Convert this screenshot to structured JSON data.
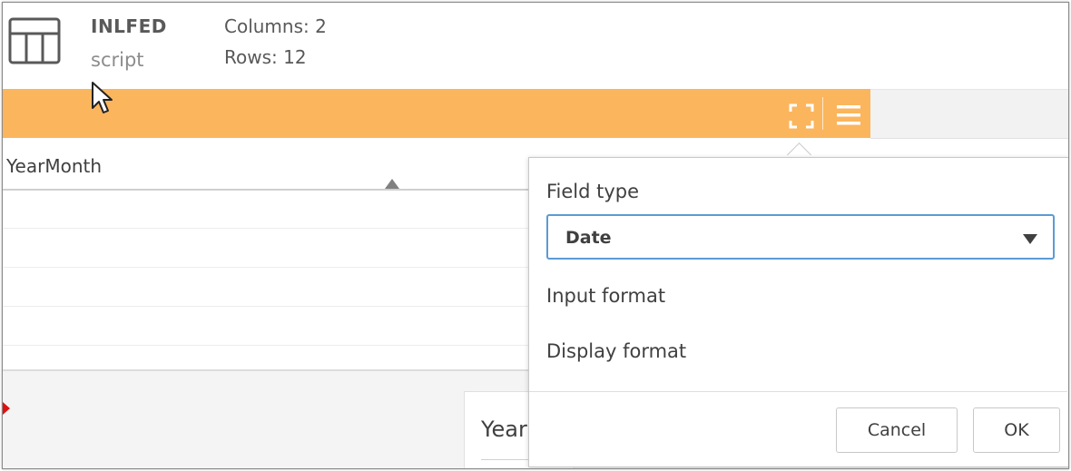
{
  "header": {
    "table_name": "INLFED",
    "table_source": "script",
    "columns_label": "Columns: 2",
    "rows_label": "Rows: 12",
    "table_icon": "table-icon"
  },
  "toolbar": {
    "accent_color": "#fbb55d",
    "expand_icon": "expand-icon",
    "menu_icon": "hamburger-menu-icon"
  },
  "table": {
    "column_header": "YearMonth",
    "sort_icon": "sort-ascending-icon"
  },
  "lower_panel": {
    "card_text": "Year"
  },
  "popover": {
    "field_type_label": "Field type",
    "field_type_value": "Date",
    "input_format_label": "Input format",
    "display_format_label": "Display format",
    "cancel_label": "Cancel",
    "ok_label": "OK",
    "focus_color": "#5b9bd5"
  }
}
